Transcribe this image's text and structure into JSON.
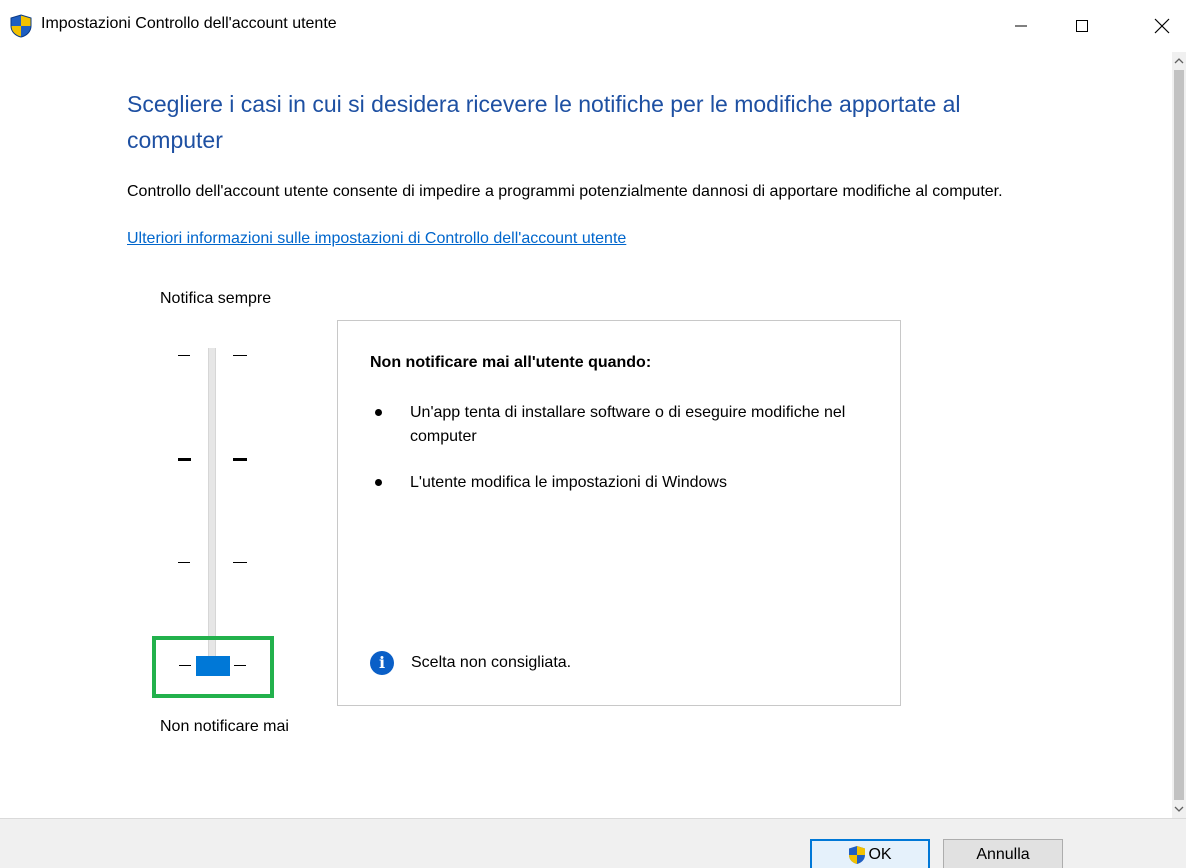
{
  "window": {
    "title": "Impostazioni Controllo dell'account utente",
    "icon": "uac-shield-icon",
    "controls": [
      "minimize-icon",
      "maximize-icon",
      "close-icon"
    ]
  },
  "content": {
    "headline": "Scegliere i casi in cui si desidera ricevere le notifiche per le modifiche apportate al computer",
    "description": "Controllo dell'account utente consente di impedire a programmi potenzialmente dannosi di apportare modifiche al computer.",
    "more_info_link": "Ulteriori informazioni sulle impostazioni di Controllo dell'account utente"
  },
  "slider": {
    "top_label": "Notifica sempre",
    "bottom_label": "Non notificare mai",
    "levels": 4,
    "selected_level": 1
  },
  "panel": {
    "title": "Non notificare mai all'utente quando:",
    "items": [
      "Un'app tenta di installare software o di eseguire modifiche nel computer",
      "L'utente modifica le impostazioni di Windows"
    ],
    "note": "Scelta non consigliata."
  },
  "buttons": {
    "ok": "OK",
    "cancel": "Annulla"
  },
  "colors": {
    "headline": "#1e50a2",
    "link": "#0066cc",
    "slider_thumb": "#0078d7",
    "focus_highlight": "#22b14c",
    "info_icon": "#0a5fc7"
  }
}
